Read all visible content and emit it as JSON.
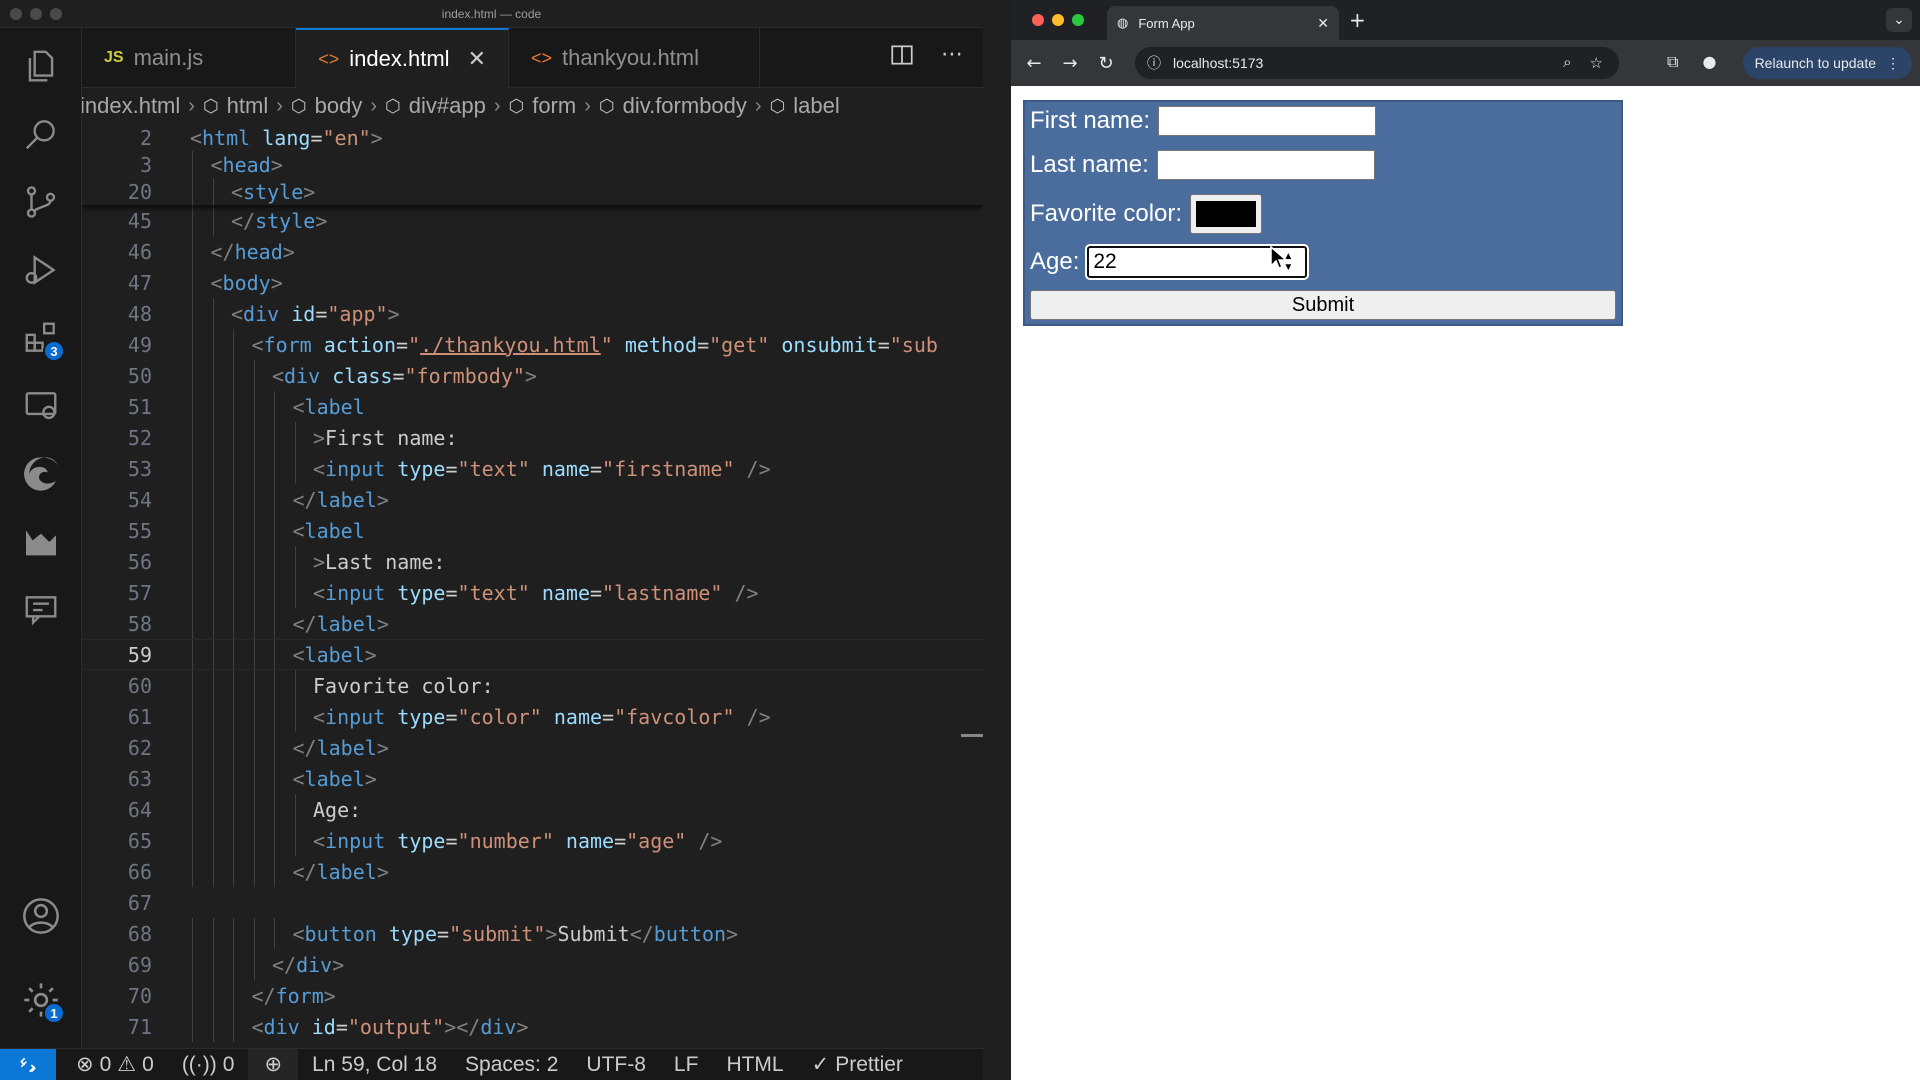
{
  "vscode": {
    "window_title": "index.html — code",
    "tabs": [
      {
        "icon": "JS",
        "label": "main.js"
      },
      {
        "icon": "<>",
        "label": "index.html"
      },
      {
        "icon": "<>",
        "label": "thankyou.html"
      }
    ],
    "breadcrumb": [
      "index.html",
      "html",
      "body",
      "div#app",
      "form",
      "div.formbody",
      "label"
    ],
    "extensions_badge": "3",
    "settings_badge": "1",
    "status": {
      "errors": "0",
      "warnings": "0",
      "ports": "0",
      "position": "Ln 59, Col 18",
      "spaces": "Spaces: 2",
      "encoding": "UTF-8",
      "eol": "LF",
      "language": "HTML",
      "formatter": "Prettier"
    },
    "sticky_lines": [
      {
        "n": "2",
        "indent": 0,
        "code": [
          [
            "tg",
            "<"
          ],
          [
            "tn",
            "html"
          ],
          [
            "t",
            " "
          ],
          [
            "at",
            "lang"
          ],
          [
            "t",
            "="
          ],
          [
            "av",
            "\"en\""
          ],
          [
            "tg",
            ">"
          ]
        ]
      },
      {
        "n": "3",
        "indent": 1,
        "code": [
          [
            "tg",
            "<"
          ],
          [
            "tn",
            "head"
          ],
          [
            "tg",
            ">"
          ]
        ]
      },
      {
        "n": "20",
        "indent": 2,
        "code": [
          [
            "tg",
            "<"
          ],
          [
            "tn",
            "style"
          ],
          [
            "tg",
            ">"
          ]
        ]
      }
    ],
    "lines": [
      {
        "n": "45",
        "indent": 2,
        "code": [
          [
            "tg",
            "</"
          ],
          [
            "tn",
            "style"
          ],
          [
            "tg",
            ">"
          ]
        ]
      },
      {
        "n": "46",
        "indent": 1,
        "code": [
          [
            "tg",
            "</"
          ],
          [
            "tn",
            "head"
          ],
          [
            "tg",
            ">"
          ]
        ]
      },
      {
        "n": "47",
        "indent": 1,
        "code": [
          [
            "tg",
            "<"
          ],
          [
            "tn",
            "body"
          ],
          [
            "tg",
            ">"
          ]
        ]
      },
      {
        "n": "48",
        "indent": 2,
        "code": [
          [
            "tg",
            "<"
          ],
          [
            "tn",
            "div"
          ],
          [
            "t",
            " "
          ],
          [
            "at",
            "id"
          ],
          [
            "t",
            "="
          ],
          [
            "av",
            "\"app\""
          ],
          [
            "tg",
            ">"
          ]
        ]
      },
      {
        "n": "49",
        "indent": 3,
        "code": [
          [
            "tg",
            "<"
          ],
          [
            "tn",
            "form"
          ],
          [
            "t",
            " "
          ],
          [
            "at",
            "action"
          ],
          [
            "t",
            "="
          ],
          [
            "av",
            "\""
          ],
          [
            "avu",
            "./thankyou.html"
          ],
          [
            "av",
            "\""
          ],
          [
            "t",
            " "
          ],
          [
            "at",
            "method"
          ],
          [
            "t",
            "="
          ],
          [
            "av",
            "\"get\""
          ],
          [
            "t",
            " "
          ],
          [
            "at",
            "onsubmit"
          ],
          [
            "t",
            "="
          ],
          [
            "av",
            "\"sub"
          ]
        ]
      },
      {
        "n": "50",
        "indent": 4,
        "code": [
          [
            "tg",
            "<"
          ],
          [
            "tn",
            "div"
          ],
          [
            "t",
            " "
          ],
          [
            "at",
            "class"
          ],
          [
            "t",
            "="
          ],
          [
            "av",
            "\"formbody\""
          ],
          [
            "tg",
            ">"
          ]
        ]
      },
      {
        "n": "51",
        "indent": 5,
        "code": [
          [
            "tg",
            "<"
          ],
          [
            "tn",
            "label"
          ]
        ]
      },
      {
        "n": "52",
        "indent": 6,
        "code": [
          [
            "tg",
            ">"
          ],
          [
            "t",
            "First name:"
          ]
        ]
      },
      {
        "n": "53",
        "indent": 6,
        "code": [
          [
            "tg",
            "<"
          ],
          [
            "tn",
            "input"
          ],
          [
            "t",
            " "
          ],
          [
            "at",
            "type"
          ],
          [
            "t",
            "="
          ],
          [
            "av",
            "\"text\""
          ],
          [
            "t",
            " "
          ],
          [
            "at",
            "name"
          ],
          [
            "t",
            "="
          ],
          [
            "av",
            "\"firstname\""
          ],
          [
            "t",
            " "
          ],
          [
            "tg",
            "/>"
          ]
        ]
      },
      {
        "n": "54",
        "indent": 5,
        "code": [
          [
            "tg",
            "</"
          ],
          [
            "tn",
            "label"
          ],
          [
            "tg",
            ">"
          ]
        ]
      },
      {
        "n": "55",
        "indent": 5,
        "code": [
          [
            "tg",
            "<"
          ],
          [
            "tn",
            "label"
          ]
        ]
      },
      {
        "n": "56",
        "indent": 6,
        "code": [
          [
            "tg",
            ">"
          ],
          [
            "t",
            "Last name:"
          ]
        ]
      },
      {
        "n": "57",
        "indent": 6,
        "code": [
          [
            "tg",
            "<"
          ],
          [
            "tn",
            "input"
          ],
          [
            "t",
            " "
          ],
          [
            "at",
            "type"
          ],
          [
            "t",
            "="
          ],
          [
            "av",
            "\"text\""
          ],
          [
            "t",
            " "
          ],
          [
            "at",
            "name"
          ],
          [
            "t",
            "="
          ],
          [
            "av",
            "\"lastname\""
          ],
          [
            "t",
            " "
          ],
          [
            "tg",
            "/>"
          ]
        ]
      },
      {
        "n": "58",
        "indent": 5,
        "code": [
          [
            "tg",
            "</"
          ],
          [
            "tn",
            "label"
          ],
          [
            "tg",
            ">"
          ]
        ]
      },
      {
        "n": "59",
        "indent": 5,
        "current": true,
        "code": [
          [
            "tg",
            "<"
          ],
          [
            "tn",
            "label"
          ],
          [
            "tg",
            ">"
          ]
        ]
      },
      {
        "n": "60",
        "indent": 6,
        "code": [
          [
            "t",
            "Favorite color:"
          ]
        ]
      },
      {
        "n": "61",
        "indent": 6,
        "code": [
          [
            "tg",
            "<"
          ],
          [
            "tn",
            "input"
          ],
          [
            "t",
            " "
          ],
          [
            "at",
            "type"
          ],
          [
            "t",
            "="
          ],
          [
            "av",
            "\"color\""
          ],
          [
            "t",
            " "
          ],
          [
            "at",
            "name"
          ],
          [
            "t",
            "="
          ],
          [
            "av",
            "\"favcolor\""
          ],
          [
            "t",
            " "
          ],
          [
            "tg",
            "/>"
          ]
        ]
      },
      {
        "n": "62",
        "indent": 5,
        "code": [
          [
            "tg",
            "</"
          ],
          [
            "tn",
            "label"
          ],
          [
            "tg",
            ">"
          ]
        ]
      },
      {
        "n": "63",
        "indent": 5,
        "code": [
          [
            "tg",
            "<"
          ],
          [
            "tn",
            "label"
          ],
          [
            "tg",
            ">"
          ]
        ]
      },
      {
        "n": "64",
        "indent": 6,
        "code": [
          [
            "t",
            "Age:"
          ]
        ]
      },
      {
        "n": "65",
        "indent": 6,
        "code": [
          [
            "tg",
            "<"
          ],
          [
            "tn",
            "input"
          ],
          [
            "t",
            " "
          ],
          [
            "at",
            "type"
          ],
          [
            "t",
            "="
          ],
          [
            "av",
            "\"number\""
          ],
          [
            "t",
            " "
          ],
          [
            "at",
            "name"
          ],
          [
            "t",
            "="
          ],
          [
            "av",
            "\"age\""
          ],
          [
            "t",
            " "
          ],
          [
            "tg",
            "/>"
          ]
        ]
      },
      {
        "n": "66",
        "indent": 5,
        "code": [
          [
            "tg",
            "</"
          ],
          [
            "tn",
            "label"
          ],
          [
            "tg",
            ">"
          ]
        ]
      },
      {
        "n": "67",
        "indent": 0,
        "code": []
      },
      {
        "n": "68",
        "indent": 5,
        "code": [
          [
            "tg",
            "<"
          ],
          [
            "tn",
            "button"
          ],
          [
            "t",
            " "
          ],
          [
            "at",
            "type"
          ],
          [
            "t",
            "="
          ],
          [
            "av",
            "\"submit\""
          ],
          [
            "tg",
            ">"
          ],
          [
            "t",
            "Submit"
          ],
          [
            "tg",
            "</"
          ],
          [
            "tn",
            "button"
          ],
          [
            "tg",
            ">"
          ]
        ]
      },
      {
        "n": "69",
        "indent": 4,
        "code": [
          [
            "tg",
            "</"
          ],
          [
            "tn",
            "div"
          ],
          [
            "tg",
            ">"
          ]
        ]
      },
      {
        "n": "70",
        "indent": 3,
        "code": [
          [
            "tg",
            "</"
          ],
          [
            "tn",
            "form"
          ],
          [
            "tg",
            ">"
          ]
        ]
      },
      {
        "n": "71",
        "indent": 3,
        "code": [
          [
            "tg",
            "<"
          ],
          [
            "tn",
            "div"
          ],
          [
            "t",
            " "
          ],
          [
            "at",
            "id"
          ],
          [
            "t",
            "="
          ],
          [
            "av",
            "\"output\""
          ],
          [
            "tg",
            "></"
          ],
          [
            "tn",
            "div"
          ],
          [
            "tg",
            ">"
          ]
        ]
      }
    ]
  },
  "browser": {
    "tab_title": "Form App",
    "url": "localhost:5173",
    "relaunch_label": "Relaunch to update",
    "form": {
      "first_name_label": "First name:",
      "first_name_value": "",
      "last_name_label": "Last name:",
      "last_name_value": "",
      "favorite_color_label": "Favorite color:",
      "favorite_color_value": "#000000",
      "age_label": "Age:",
      "age_value": "22",
      "submit_label": "Submit"
    }
  }
}
